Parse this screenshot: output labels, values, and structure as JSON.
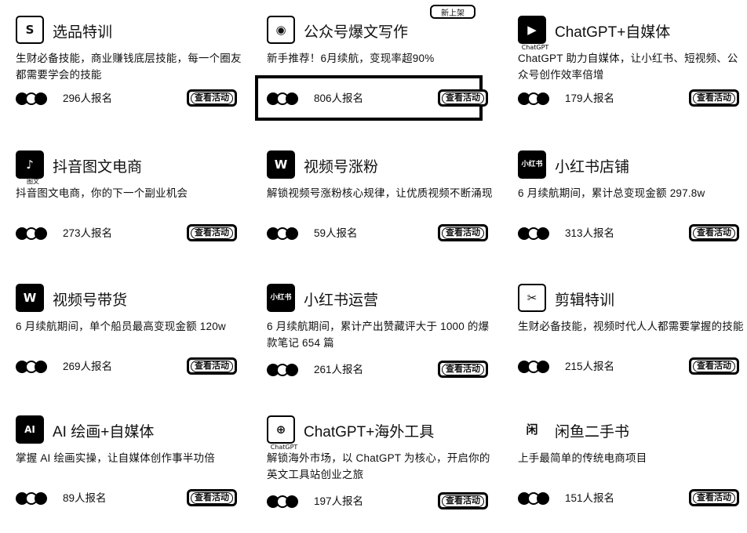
{
  "badge": "新上架",
  "courses": [
    {
      "id": "c1",
      "title": "选品特训",
      "desc": "生财必备技能，商业赚钱底层技能，每一个圈友都需要学会的技能",
      "count": "296人报名",
      "button": "查看活动",
      "icon": "shopping-bag-icon",
      "glyph": "S"
    },
    {
      "id": "c2",
      "title": "公众号爆文写作",
      "desc": "新手推荐！6月续航，变现率超90%",
      "count": "806人报名",
      "button": "查看活动",
      "icon": "wechat-spiral-icon",
      "glyph": "◉"
    },
    {
      "id": "c3",
      "title": "ChatGPT+自媒体",
      "desc": "ChatGPT 助力自媒体，让小红书、短视频、公众号创作效率倍增",
      "count": "179人报名",
      "button": "查看活动",
      "icon": "chatgpt-video-icon",
      "glyph": "▶",
      "sub": "ChatGPT"
    },
    {
      "id": "c4",
      "title": "抖音图文电商",
      "desc": "抖音图文电商，你的下一个副业机会",
      "count": "273人报名",
      "button": "查看活动",
      "icon": "douyin-icon",
      "glyph": "♪",
      "sub": "图文"
    },
    {
      "id": "c5",
      "title": "视频号涨粉",
      "desc": "解锁视频号涨粉核心规律，让优质视频不断涌现",
      "count": "59人报名",
      "button": "查看活动",
      "icon": "channels-icon",
      "glyph": "W"
    },
    {
      "id": "c6",
      "title": "小红书店铺",
      "desc": "6 月续航期间，累计总变现金额 297.8w",
      "count": "313人报名",
      "button": "查看活动",
      "icon": "xiaohongshu-icon",
      "glyph": "小红书"
    },
    {
      "id": "c7",
      "title": "视频号带货",
      "desc": "6 月续航期间，单个船员最高变现金额 120w",
      "count": "269人报名",
      "button": "查看活动",
      "icon": "channels-icon",
      "glyph": "W"
    },
    {
      "id": "c8",
      "title": "小红书运营",
      "desc": "6 月续航期间，累计产出赞藏评大于 1000 的爆款笔记 654 篇",
      "count": "261人报名",
      "button": "查看活动",
      "icon": "xiaohongshu-icon",
      "glyph": "小红书"
    },
    {
      "id": "c9",
      "title": "剪辑特训",
      "desc": "生财必备技能，视频时代人人都需要掌握的技能",
      "count": "215人报名",
      "button": "查看活动",
      "icon": "scissors-icon",
      "glyph": "✂"
    },
    {
      "id": "c10",
      "title": "AI 绘画+自媒体",
      "desc": "掌握 AI 绘画实操，让自媒体创作事半功倍",
      "count": "89人报名",
      "button": "查看活动",
      "icon": "ai-brush-icon",
      "glyph": "AI"
    },
    {
      "id": "c11",
      "title": "ChatGPT+海外工具",
      "desc": "解锁海外市场，以 ChatGPT 为核心，开启你的英文工具站创业之旅",
      "count": "197人报名",
      "button": "查看活动",
      "icon": "globe-icon",
      "glyph": "⊕",
      "sub": "ChatGPT"
    },
    {
      "id": "c12",
      "title": "闲鱼二手书",
      "desc": "上手最简单的传统电商项目",
      "count": "151人报名",
      "button": "查看活动",
      "icon": "book-icon",
      "glyph": "闲"
    }
  ]
}
